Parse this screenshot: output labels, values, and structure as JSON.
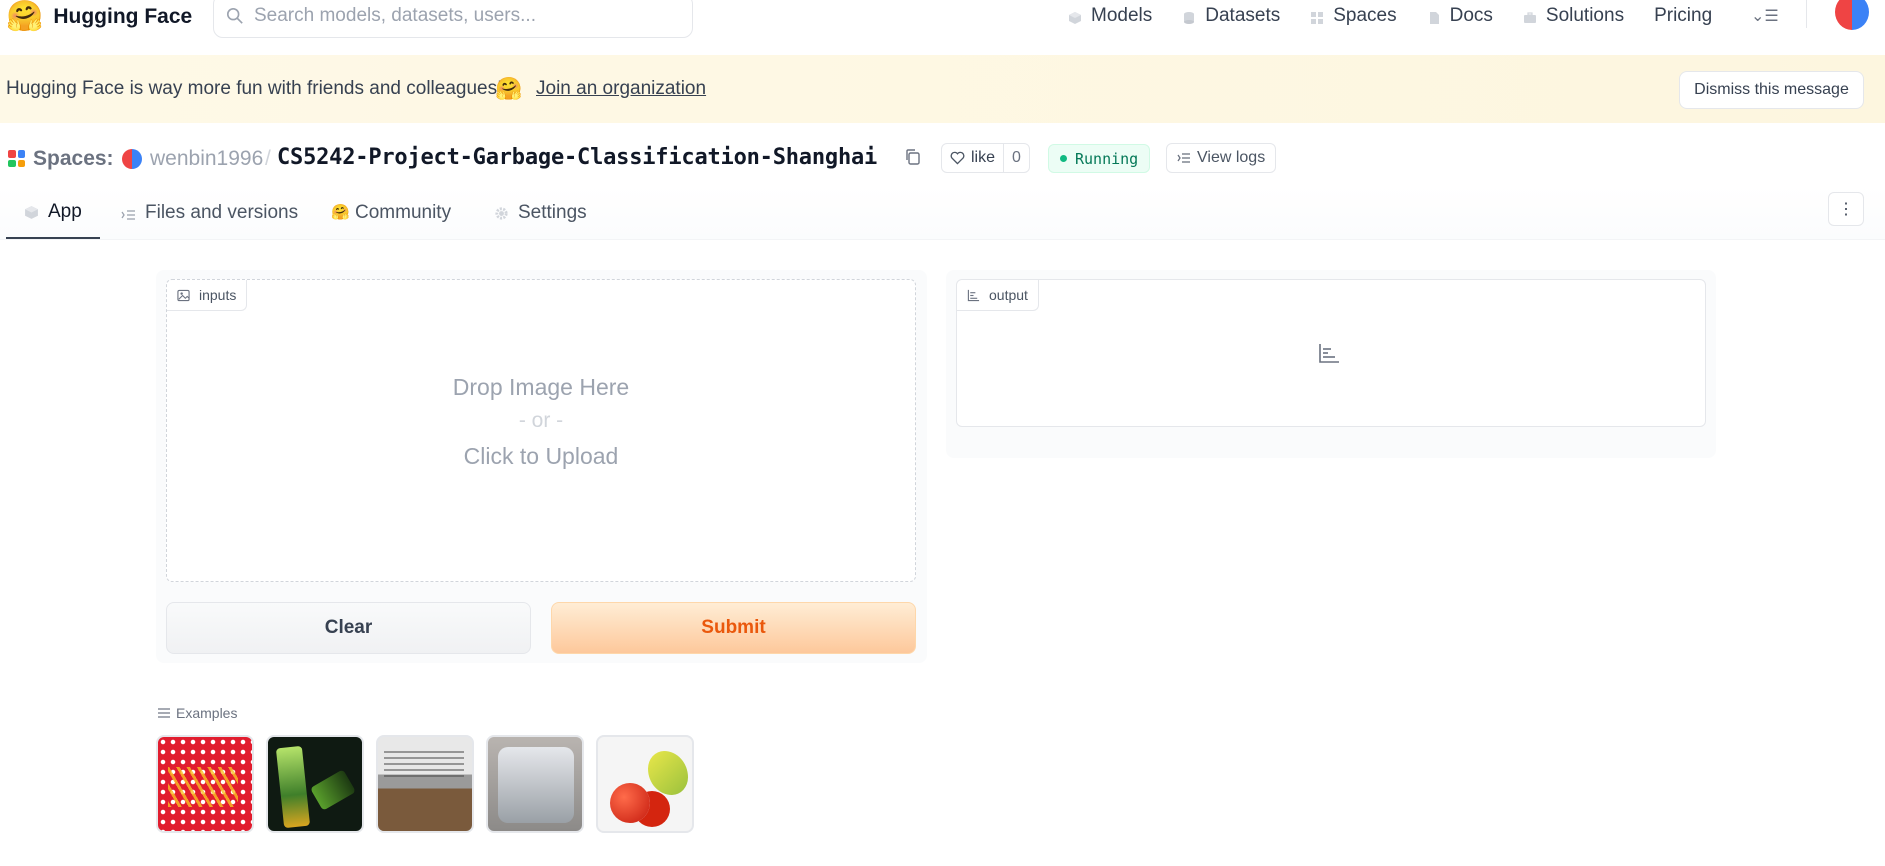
{
  "nav": {
    "brand": "Hugging Face",
    "search_placeholder": "Search models, datasets, users...",
    "links": [
      {
        "label": "Models",
        "icon": "cube-icon"
      },
      {
        "label": "Datasets",
        "icon": "database-icon"
      },
      {
        "label": "Spaces",
        "icon": "grid-icon"
      },
      {
        "label": "Docs",
        "icon": "doc-icon"
      },
      {
        "label": "Solutions",
        "icon": "briefcase-icon"
      },
      {
        "label": "Pricing",
        "icon": ""
      }
    ]
  },
  "banner": {
    "text": "Hugging Face is way more fun with friends and colleagues!",
    "link": "Join an organization",
    "dismiss": "Dismiss this message"
  },
  "space": {
    "section_label": "Spaces:",
    "owner": "wenbin1996",
    "separator": "/",
    "name": "CS5242-Project-Garbage-Classification-Shanghai",
    "like_label": "like",
    "like_count": "0",
    "status": "Running",
    "logs_label": "View logs"
  },
  "tabs": [
    {
      "label": "App",
      "active": true
    },
    {
      "label": "Files and versions",
      "active": false
    },
    {
      "label": "Community",
      "active": false
    },
    {
      "label": "Settings",
      "active": false
    }
  ],
  "app": {
    "input_label": "inputs",
    "output_label": "output",
    "drop_line1": "Drop Image Here",
    "drop_or": "- or -",
    "drop_line3": "Click to Upload",
    "clear_label": "Clear",
    "submit_label": "Submit"
  },
  "examples": {
    "label": "Examples",
    "count": 5
  },
  "colors": {
    "accent_orange": "#ea580c",
    "running_green": "#047857",
    "banner_bg": "#fef9e7"
  }
}
